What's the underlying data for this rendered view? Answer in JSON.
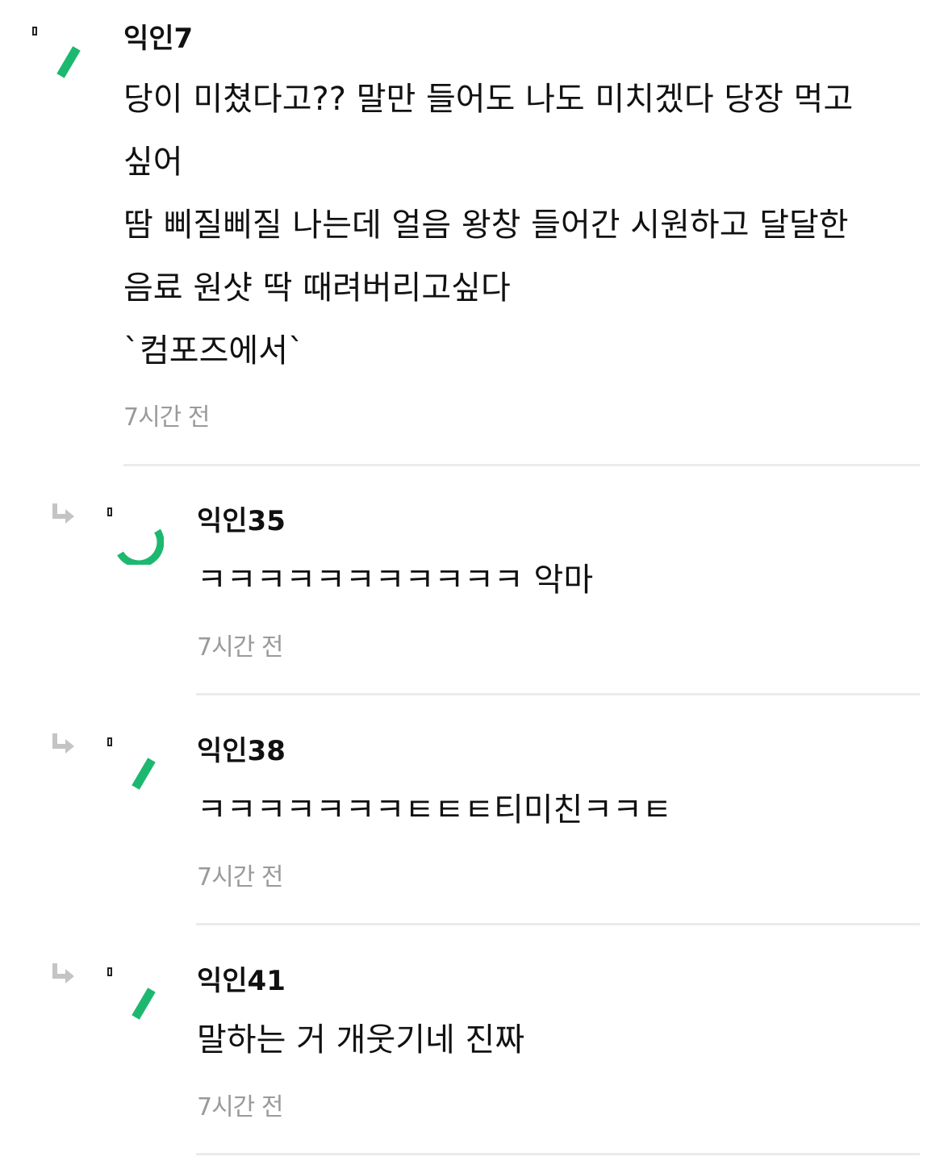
{
  "colors": {
    "accent_green": "#1db86f",
    "timestamp_gray": "#9a9a9a",
    "divider_gray": "#ebebeb",
    "reply_arrow_gray": "#c4c4c4"
  },
  "comments": [
    {
      "nickname": "익인7",
      "text": "당이 미쳤다고?? 말만 들어도 나도 미치겠다 당장 먹고\n싶어\n땀 삐질삐질 나는데 얼음 왕창 들어간 시원하고 달달한\n음료 원샷 딱 때려버리고싶다\n`컴포즈에서`",
      "time": "7시간 전",
      "is_reply": false,
      "icons": [
        "broken-image-icon",
        "avatar-mark-icon"
      ]
    },
    {
      "nickname": "익인35",
      "text": "ㅋㅋㅋㅋㅋㅋㅋㅋㅋㅋㅋ 악마",
      "time": "7시간 전",
      "is_reply": true,
      "icons": [
        "reply-arrow-icon",
        "broken-image-icon",
        "avatar-mark-icon"
      ]
    },
    {
      "nickname": "익인38",
      "text": "ㅋㅋㅋㅋㅋㅋㅋㅌㅌㅌ티미친ㅋㅋㅌ",
      "time": "7시간 전",
      "is_reply": true,
      "icons": [
        "reply-arrow-icon",
        "broken-image-icon",
        "avatar-mark-icon"
      ]
    },
    {
      "nickname": "익인41",
      "text": "말하는 거 개웃기네 진짜",
      "time": "7시간 전",
      "is_reply": true,
      "icons": [
        "reply-arrow-icon",
        "broken-image-icon",
        "avatar-mark-icon"
      ]
    }
  ]
}
